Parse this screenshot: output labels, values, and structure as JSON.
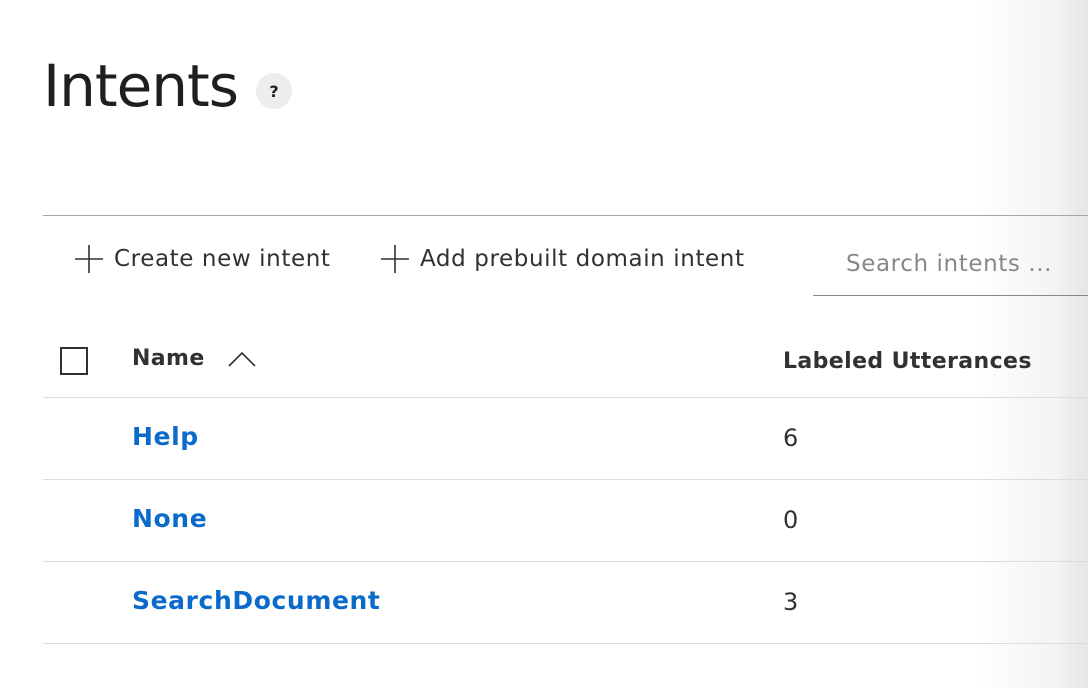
{
  "page": {
    "title": "Intents",
    "help_label": "?"
  },
  "toolbar": {
    "create_label": "Create new intent",
    "prebuilt_label": "Add prebuilt domain intent",
    "search_placeholder": "Search intents ...",
    "search_value": ""
  },
  "table": {
    "columns": {
      "name": "Name",
      "utterances": "Labeled Utterances"
    },
    "sort": "ascending",
    "rows": [
      {
        "name": "Help",
        "count": "6"
      },
      {
        "name": "None",
        "count": "0"
      },
      {
        "name": "SearchDocument",
        "count": "3"
      }
    ]
  },
  "colors": {
    "link": "#0b6bcb",
    "text": "#323130",
    "divider": "#dcdcdc"
  },
  "icons": {
    "add": "plus-icon",
    "sort": "chevron-up-icon",
    "help": "question-icon"
  }
}
